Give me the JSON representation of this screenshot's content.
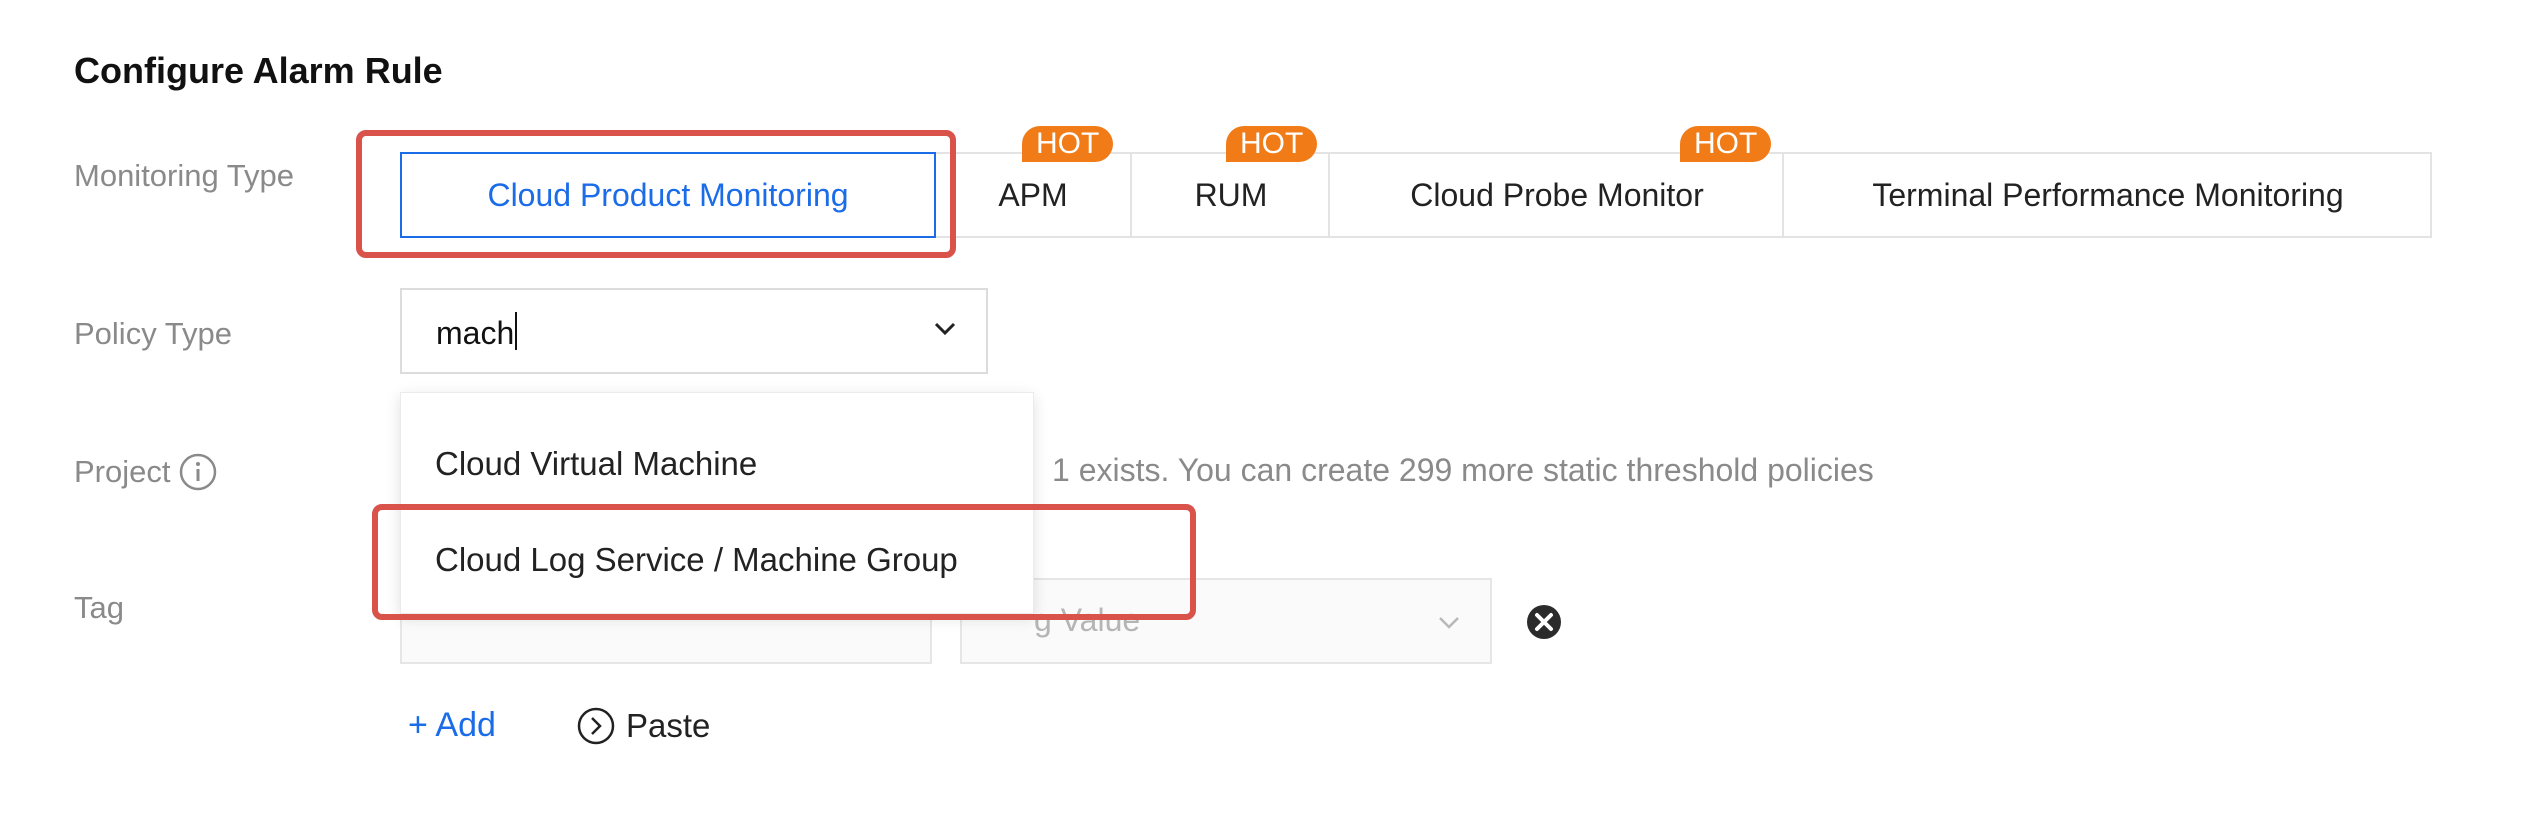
{
  "section": {
    "title": "Configure Alarm Rule"
  },
  "labels": {
    "monitoring_type": "Monitoring Type",
    "policy_type": "Policy Type",
    "project": "Project",
    "tag": "Tag"
  },
  "monitoring_tabs": [
    {
      "label": "Cloud Product Monitoring",
      "active": true,
      "hot": false
    },
    {
      "label": "APM",
      "active": false,
      "hot": true,
      "badge": "HOT"
    },
    {
      "label": "RUM",
      "active": false,
      "hot": true,
      "badge": "HOT"
    },
    {
      "label": "Cloud Probe Monitor",
      "active": false,
      "hot": true,
      "badge": "HOT"
    },
    {
      "label": "Terminal Performance Monitoring",
      "active": false,
      "hot": false
    }
  ],
  "policy_type": {
    "value": "mach"
  },
  "dropdown": {
    "options": [
      "Cloud Virtual Machine",
      "Cloud Log Service / Machine Group"
    ]
  },
  "project_info": "1 exists. You can create 299 more static threshold policies",
  "tag": {
    "value_placeholder_visible": "g Value"
  },
  "actions": {
    "add_label": "+ Add",
    "paste_label": "Paste"
  },
  "colors": {
    "accent": "#1a6ce8",
    "hot_badge": "#f07b17",
    "highlight": "#d9534a"
  }
}
